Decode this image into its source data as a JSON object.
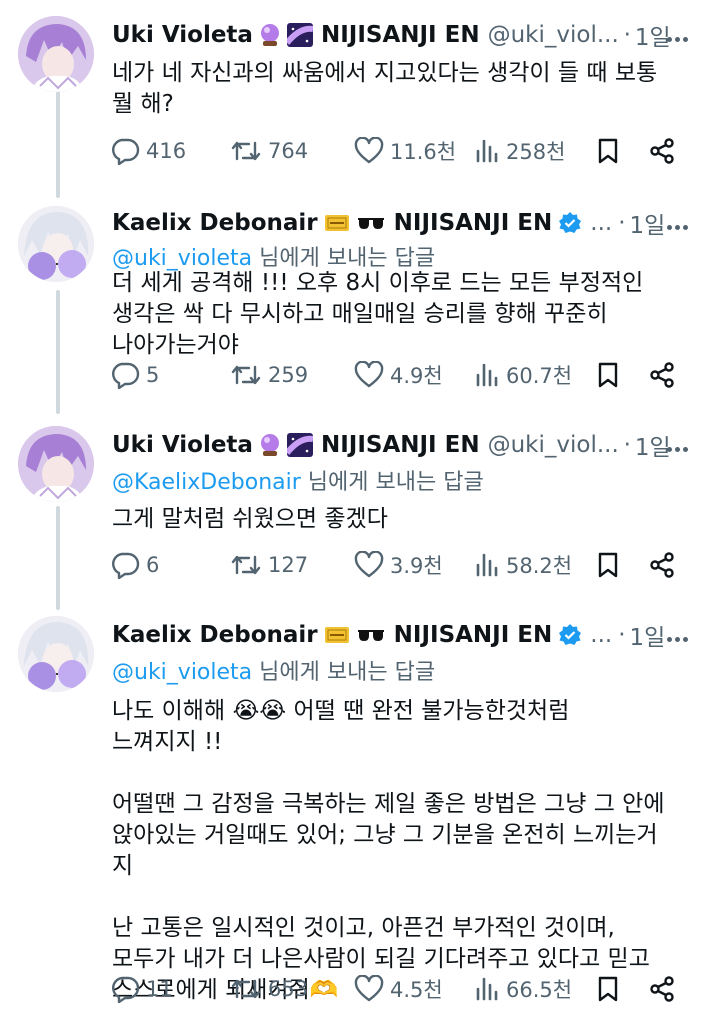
{
  "tweets": [
    {
      "name": "Uki Violeta",
      "org": "NIJISANJI EN",
      "handle": "@uki_viol...",
      "time": "1일",
      "reply_mention": "",
      "reply_suffix": "",
      "text": "네가 네 자신과의 싸움에서 지고있다는 생각이 들 때 보통\n뭘 해?",
      "replies": "416",
      "retweets": "764",
      "likes": "11.6천",
      "views": "258천"
    },
    {
      "name": "Kaelix Debonair",
      "org": "NIJISANJI EN",
      "handle": "...",
      "time": "1일",
      "reply_mention": "@uki_violeta",
      "reply_suffix": " 님에게 보내는 답글",
      "text": "더 세게 공격해 !!! 오후 8시 이후로 드는 모든 부정적인\n생각은 싹 다 무시하고 매일매일 승리를 향해 꾸준히\n나아가는거야",
      "replies": "5",
      "retweets": "259",
      "likes": "4.9천",
      "views": "60.7천"
    },
    {
      "name": "Uki Violeta",
      "org": "NIJISANJI EN",
      "handle": "@uki_viol...",
      "time": "1일",
      "reply_mention": "@KaelixDebonair",
      "reply_suffix": " 님에게 보내는 답글",
      "text": "그게 말처럼 쉬웠으면 좋겠다",
      "replies": "6",
      "retweets": "127",
      "likes": "3.9천",
      "views": "58.2천"
    },
    {
      "name": "Kaelix Debonair",
      "org": "NIJISANJI EN",
      "handle": "...",
      "time": "1일",
      "reply_mention": "@uki_violeta",
      "reply_suffix": " 님에게 보내는 답글",
      "text_line1_a": "나도 이해해 ",
      "text_line1_emoji": "😭😭",
      "text_line1_b": " 어떨 땐 완전 불가능한것처럼",
      "text_rest": "느껴지지 !!\n\n어떨땐 그 감정을 극복하는 제일 좋은 방법은 그냥 그 안에\n앉아있는 거일때도 있어; 그냥 그 기분을 온전히 느끼는거지\n\n난 고통은 일시적인 것이고, 아픈건 부가적인 것이며,\n모두가 내가 더 나은사람이 되길 기다려주고 있다고 믿고\n스스로에게 되새겨줘",
      "text_end_emoji": "🫶",
      "replies": "11",
      "retweets": "653",
      "likes": "4.5천",
      "views": "66.5천"
    }
  ],
  "colors": {
    "text": "#0f1419",
    "muted": "#536471",
    "link": "#1d9bf0",
    "thread_line": "#cfd9de"
  },
  "icons": [
    "reply-icon",
    "retweet-icon",
    "like-icon",
    "views-icon",
    "bookmark-icon",
    "share-icon",
    "verified-icon",
    "more-icon"
  ]
}
